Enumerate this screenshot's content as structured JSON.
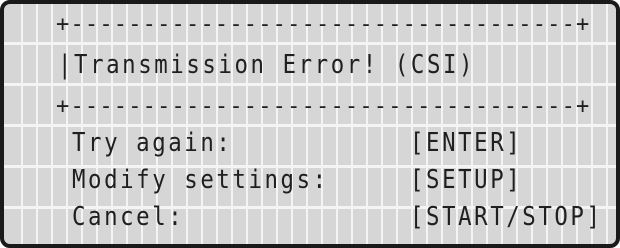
{
  "dialog": {
    "border_top": "+-----------------------------------+",
    "title_line": "|Transmission Error! (CSI)          |",
    "border_bottom": "+-----------------------------------+",
    "options": [
      {
        "label": "Try again:",
        "key": "[ENTER]"
      },
      {
        "label": "Modify settings:",
        "key": "[SETUP]"
      },
      {
        "label": "Cancel:",
        "key": "[START/STOP]"
      }
    ]
  },
  "colors": {
    "screen_background": "#d6d6d6",
    "pixel_grid": "#f4f4f4",
    "text": "#1f1f1f",
    "bezel": "#1a1a1a"
  }
}
